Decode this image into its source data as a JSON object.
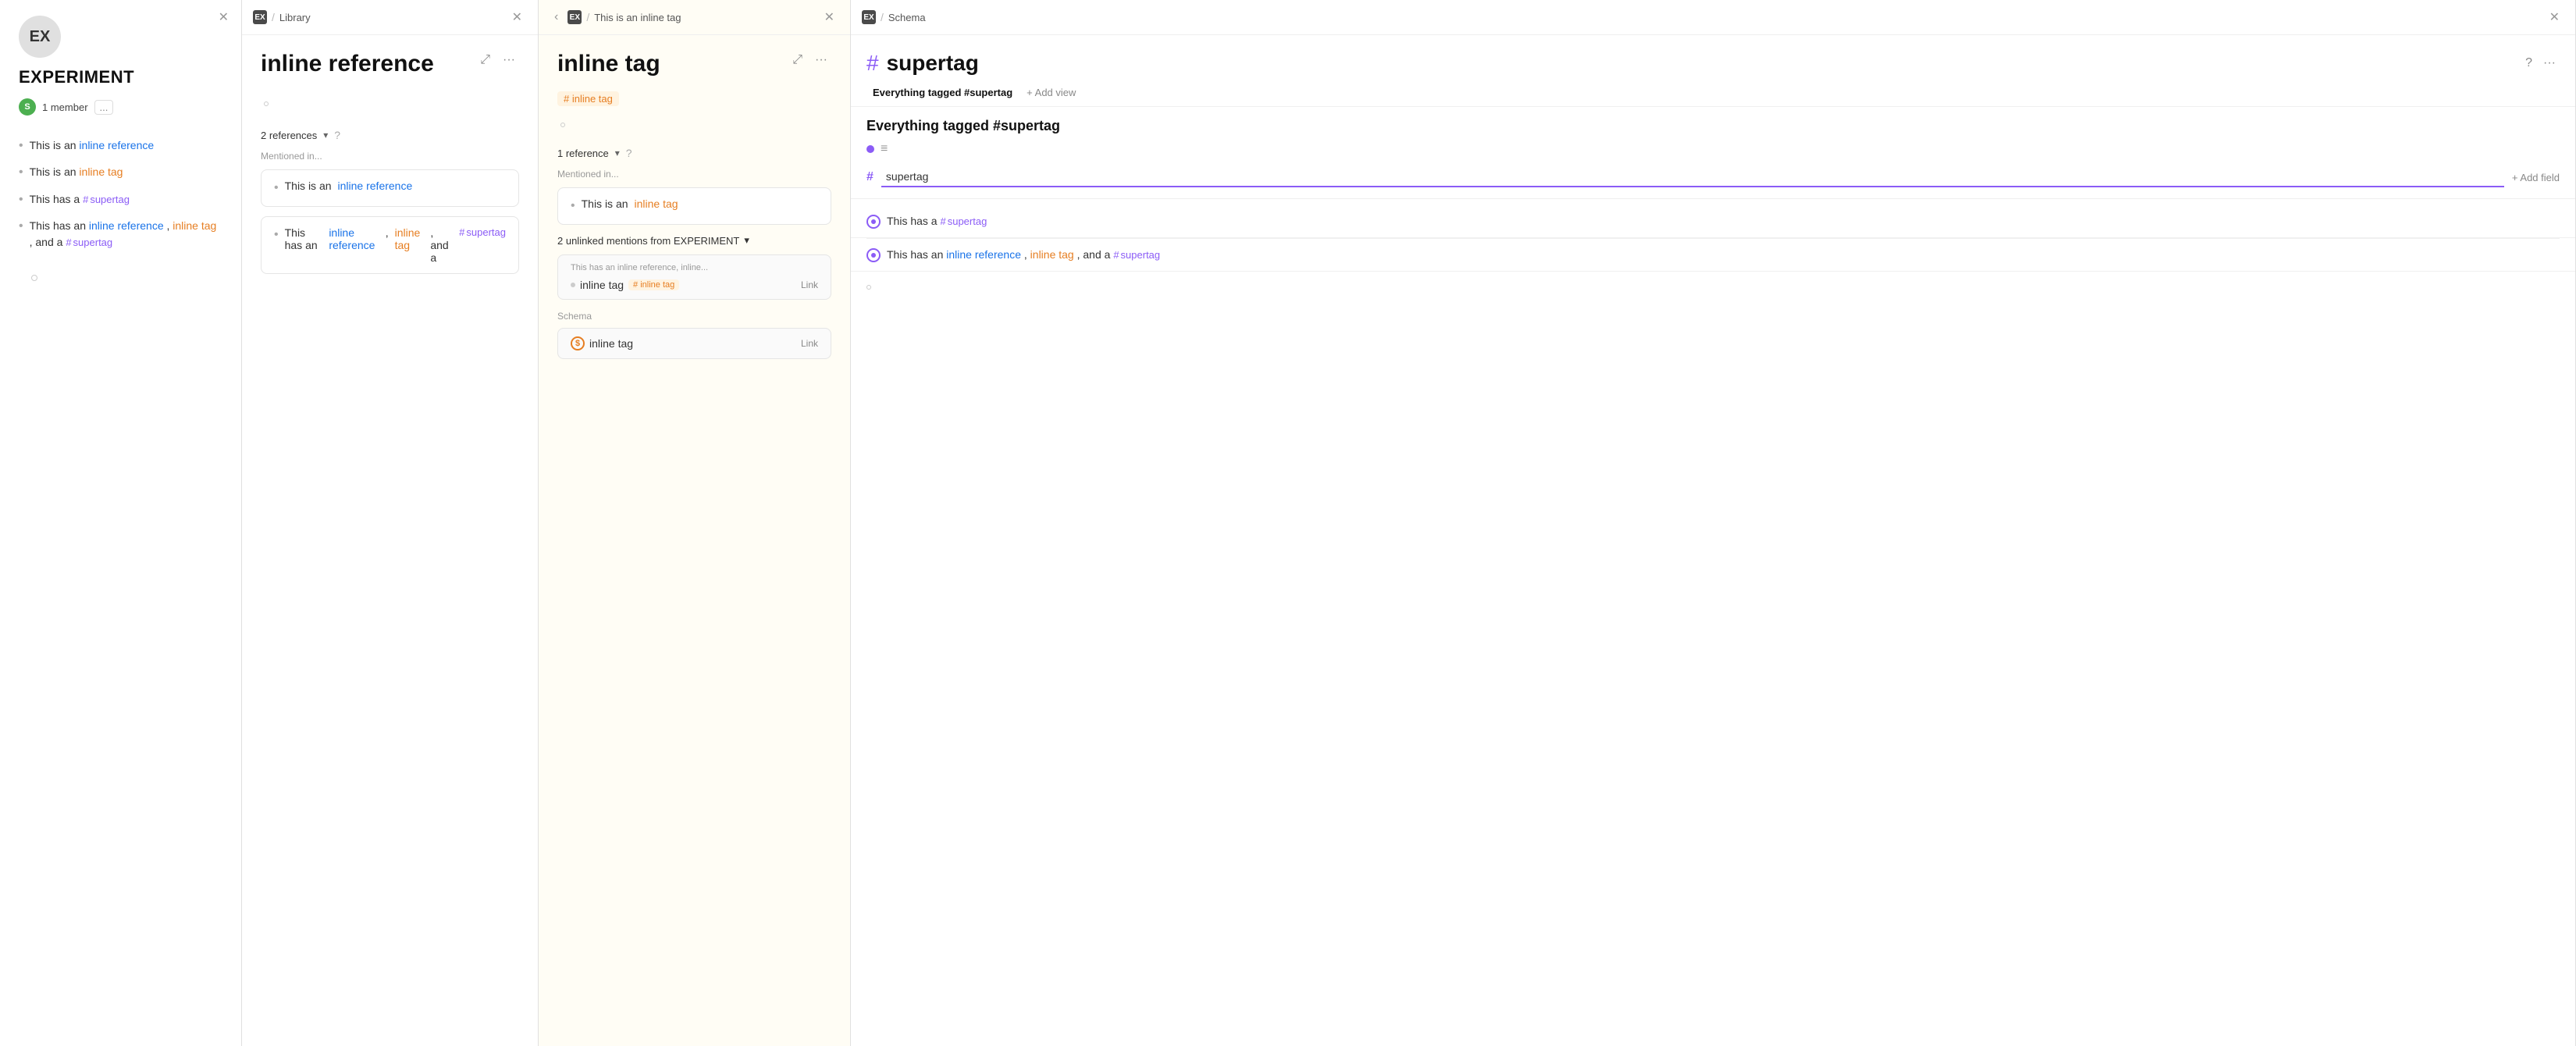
{
  "panel1": {
    "logo_text": "EX",
    "workspace_name": "EXPERIMENT",
    "member_count": "1 member",
    "member_initial": "S",
    "more_label": "...",
    "list_items": [
      {
        "prefix": "This is an ",
        "link_text": "inline reference",
        "link_color": "blue"
      },
      {
        "prefix": "This is an ",
        "link_text": "inline tag",
        "link_color": "orange"
      },
      {
        "prefix": "This has a ",
        "tag_text": "# supertag",
        "tag_type": "supertag"
      },
      {
        "prefix": "This has an ",
        "link1_text": "inline reference",
        "link1_color": "blue",
        "middle": ", ",
        "link2_text": "inline tag",
        "link2_color": "orange",
        "suffix": ", and a ",
        "tag_text": "# supertag",
        "tag_type": "complex"
      }
    ]
  },
  "panel2": {
    "breadcrumb_icon": "EX",
    "breadcrumb_sep": "/",
    "breadcrumb_title": "Library",
    "title": "inline reference",
    "references_count": "2 references",
    "references_chevron": "▾",
    "mentioned_in_label": "Mentioned in...",
    "ref_card_1": {
      "prefix": "This is an ",
      "link_text": "inline reference",
      "link_color": "blue"
    },
    "ref_card_2": {
      "prefix": "This has an ",
      "link1_text": "inline reference",
      "link1_color": "blue",
      "middle": ", ",
      "link2_text": "inline tag",
      "link2_color": "orange",
      "suffix": ", and a ",
      "tag_text": "# supertag"
    }
  },
  "panel3": {
    "breadcrumb_icon": "EX",
    "breadcrumb_sep": "/",
    "breadcrumb_title": "This is an inline tag",
    "title": "inline tag",
    "tag_badge": "# inline tag",
    "ref_count": "1 reference",
    "ref_chevron": "▾",
    "mentioned_in_label": "Mentioned in...",
    "ref_card_1": {
      "prefix": "This is an ",
      "link_text": "inline tag",
      "link_color": "orange"
    },
    "unlinked_title": "2 unlinked mentions from EXPERIMENT",
    "unlinked_chevron": "▾",
    "unlinked_preview": "This has an inline reference, inline...",
    "unlinked_item1": "inline tag",
    "unlinked_item1_badge": "# inline tag",
    "unlinked_link_label": "Link",
    "schema_label": "Schema",
    "schema_item": "inline tag",
    "schema_link_label": "Link"
  },
  "panel4": {
    "breadcrumb_icon": "EX",
    "breadcrumb_sep": "/",
    "breadcrumb_title": "Schema",
    "hash_symbol": "#",
    "title": "supertag",
    "tab_label": "Everything tagged #supertag",
    "add_view_label": "+ Add view",
    "section_title": "Everything tagged #supertag",
    "field_value": "supertag",
    "add_field_label": "+ Add field",
    "entry1": {
      "prefix": "This has a ",
      "tag_text": "# supertag"
    },
    "entry2": {
      "prefix": "This has an ",
      "link1_text": "inline reference",
      "link1_color": "blue",
      "middle": ", ",
      "link2_text": "inline tag",
      "link2_color": "orange",
      "suffix": ", and a ",
      "tag_text": "# supertag"
    }
  },
  "icons": {
    "back": "‹",
    "close": "✕",
    "expand": "⤢",
    "dots": "···",
    "chevron_down": "▾",
    "help": "?",
    "hash": "#"
  }
}
